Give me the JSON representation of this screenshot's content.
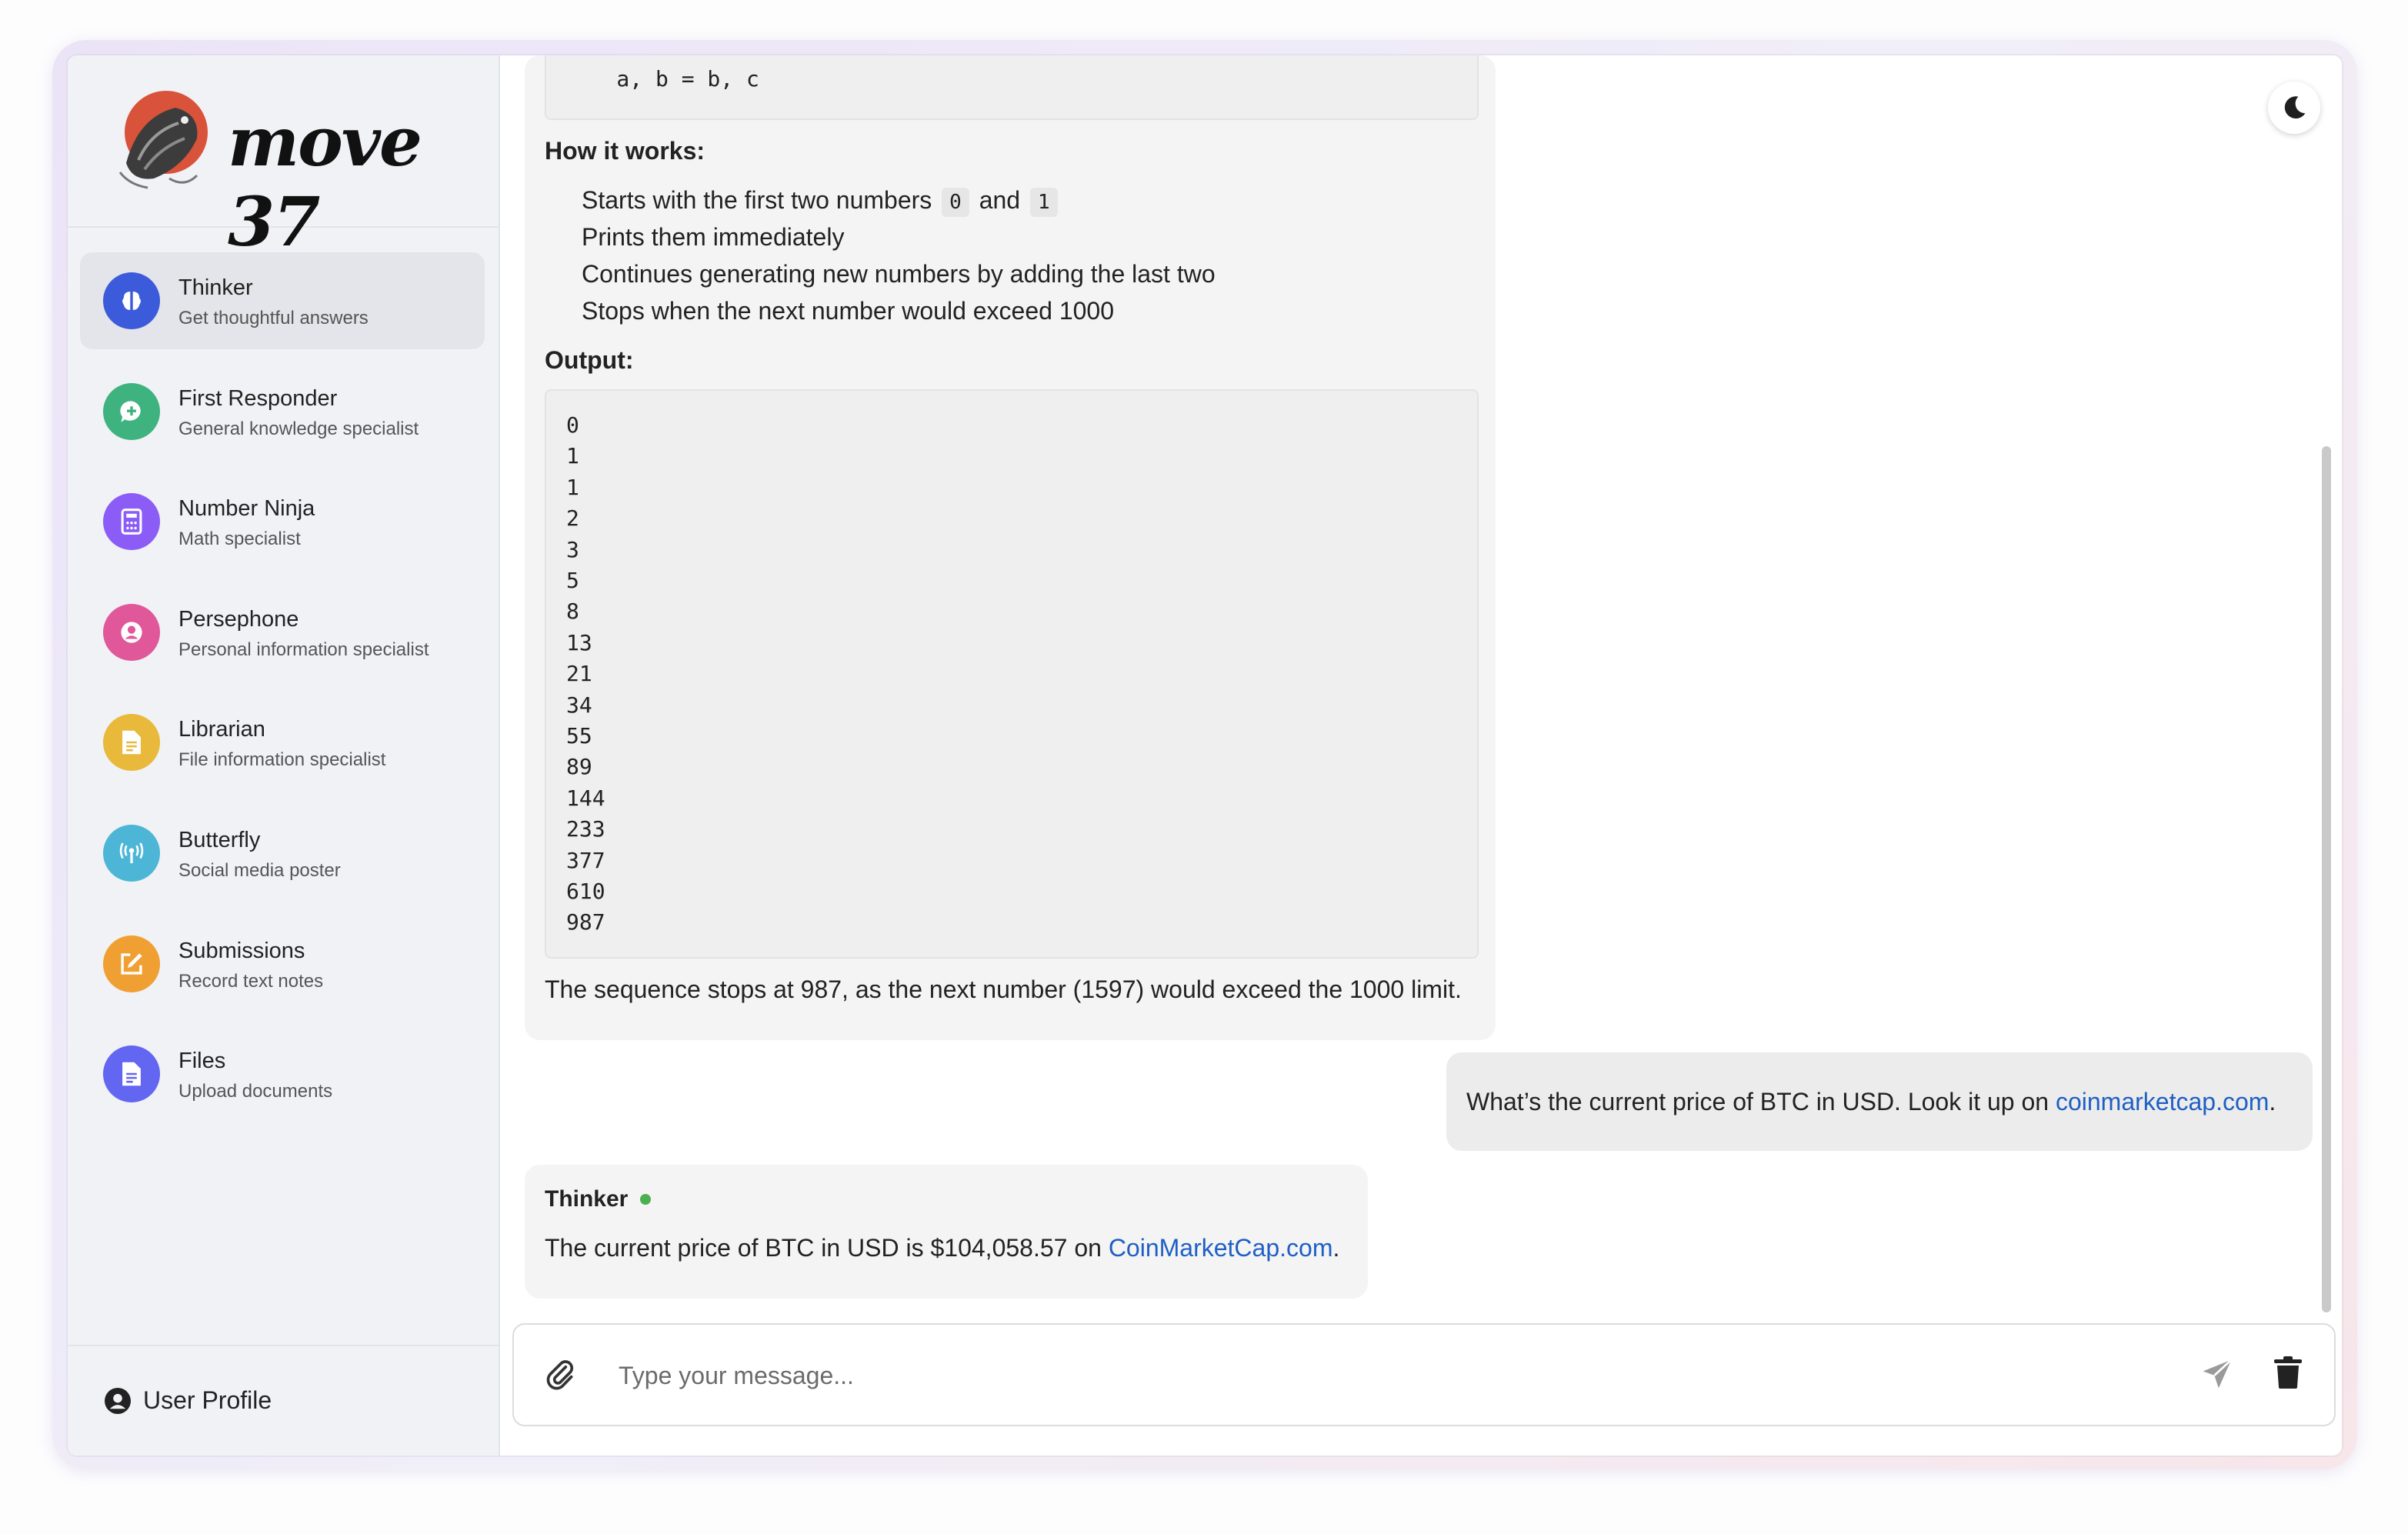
{
  "brand": {
    "name": "move 37"
  },
  "sidebar": {
    "agents": [
      {
        "name": "Thinker",
        "desc": "Get thoughtful answers",
        "color": "#3b5bdb",
        "icon": "brain-icon"
      },
      {
        "name": "First Responder",
        "desc": "General knowledge specialist",
        "color": "#3fb37f",
        "icon": "chat-plus-icon"
      },
      {
        "name": "Number Ninja",
        "desc": "Math specialist",
        "color": "#8b5cf6",
        "icon": "calculator-icon"
      },
      {
        "name": "Persephone",
        "desc": "Personal information specialist",
        "color": "#e0589a",
        "icon": "user-circle-icon"
      },
      {
        "name": "Librarian",
        "desc": "File information specialist",
        "color": "#e8b93a",
        "icon": "document-icon"
      },
      {
        "name": "Butterfly",
        "desc": "Social media poster",
        "color": "#4db6d6",
        "icon": "broadcast-icon"
      },
      {
        "name": "Submissions",
        "desc": "Record text notes",
        "color": "#f0a033",
        "icon": "edit-icon"
      },
      {
        "name": "Files",
        "desc": "Upload documents",
        "color": "#6366f1",
        "icon": "file-icon"
      }
    ],
    "profile_label": "User Profile"
  },
  "chat": {
    "code_tail": "    a, b = b, c",
    "how_label": "How it works:",
    "how_items": {
      "item1_pre": "Starts with the first two numbers",
      "item1_code_a": "0",
      "item1_mid": "and",
      "item1_code_b": "1",
      "item2": "Prints them immediately",
      "item3": "Continues generating new numbers by adding the last two",
      "item4": "Stops when the next number would exceed 1000"
    },
    "output_label": "Output:",
    "output_values": [
      "0",
      "1",
      "1",
      "2",
      "3",
      "5",
      "8",
      "13",
      "21",
      "34",
      "55",
      "89",
      "144",
      "233",
      "377",
      "610",
      "987"
    ],
    "conclusion": "The sequence stops at 987, as the next number (1597) would exceed the 1000 limit.",
    "user_message": {
      "text": "What’s the current price of BTC in USD. Look it up on ",
      "link": "coinmarketcap.com",
      "end": "."
    },
    "reply": {
      "sender": "Thinker",
      "status_color": "#4caf50",
      "text": "The current price of BTC in USD is $104,058.57 on ",
      "link": "CoinMarketCap.com",
      "end": "."
    }
  },
  "composer": {
    "placeholder": "Type your message..."
  }
}
